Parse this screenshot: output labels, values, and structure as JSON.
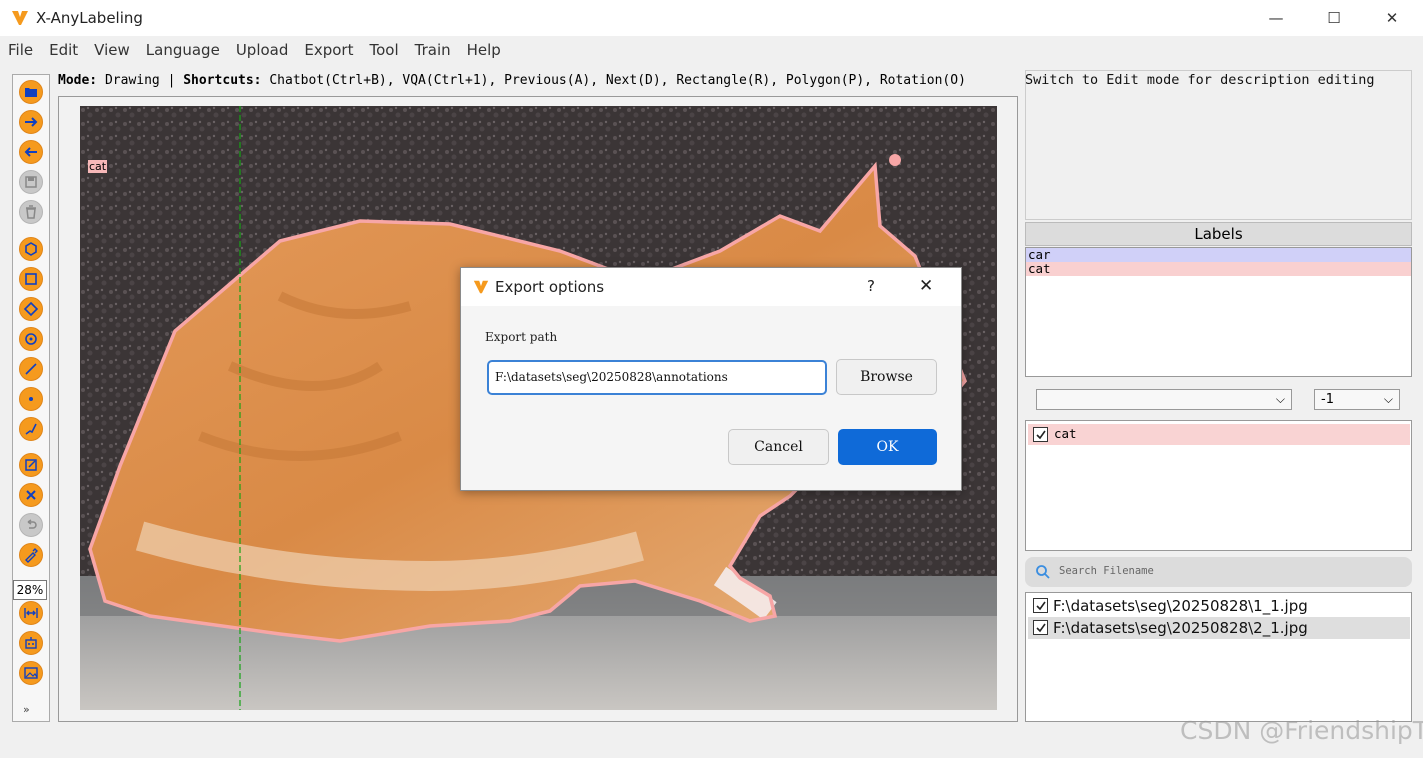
{
  "window": {
    "title": "X-AnyLabeling",
    "minimize": "—",
    "maximize": "☐",
    "close": "✕"
  },
  "menu": [
    "File",
    "Edit",
    "View",
    "Language",
    "Upload",
    "Export",
    "Tool",
    "Train",
    "Help"
  ],
  "modeline": {
    "mode_key": "Mode:",
    "mode_value": " Drawing | ",
    "shortcuts_key": "Shortcuts:",
    "shortcuts_value": " Chatbot(Ctrl+B), VQA(Ctrl+1), Previous(A), Next(D), Rectangle(R), Polygon(P), Rotation(O)"
  },
  "toolbar": {
    "zoom": "28%",
    "more": "»"
  },
  "canvas": {
    "shape_label": "cat",
    "shape_color": "#f7a6a6"
  },
  "description": {
    "text": "Switch to Edit mode for description editing"
  },
  "labels_panel": {
    "header": "Labels",
    "items": [
      {
        "name": "car",
        "color": "#d0d0f8"
      },
      {
        "name": "cat",
        "color": "#f9d0d0"
      }
    ]
  },
  "filters": {
    "label_combo": "",
    "group_combo": "-1"
  },
  "shapes": [
    {
      "label": "cat",
      "checked": true
    }
  ],
  "search": {
    "placeholder": "Search Filename"
  },
  "files": [
    {
      "path": "F:\\datasets\\seg\\20250828\\1_1.jpg",
      "checked": true
    },
    {
      "path": "F:\\datasets\\seg\\20250828\\2_1.jpg",
      "checked": true
    }
  ],
  "watermark": "CSDN @FriendshipT",
  "dialog": {
    "title": "Export options",
    "help": "?",
    "close": "✕",
    "path_label": "Export path",
    "path_value": "F:\\datasets\\seg\\20250828\\annotations",
    "browse": "Browse",
    "cancel": "Cancel",
    "ok": "OK"
  },
  "colors": {
    "accent": "#0f6ad8",
    "tool_orange": "#f59a1e"
  }
}
